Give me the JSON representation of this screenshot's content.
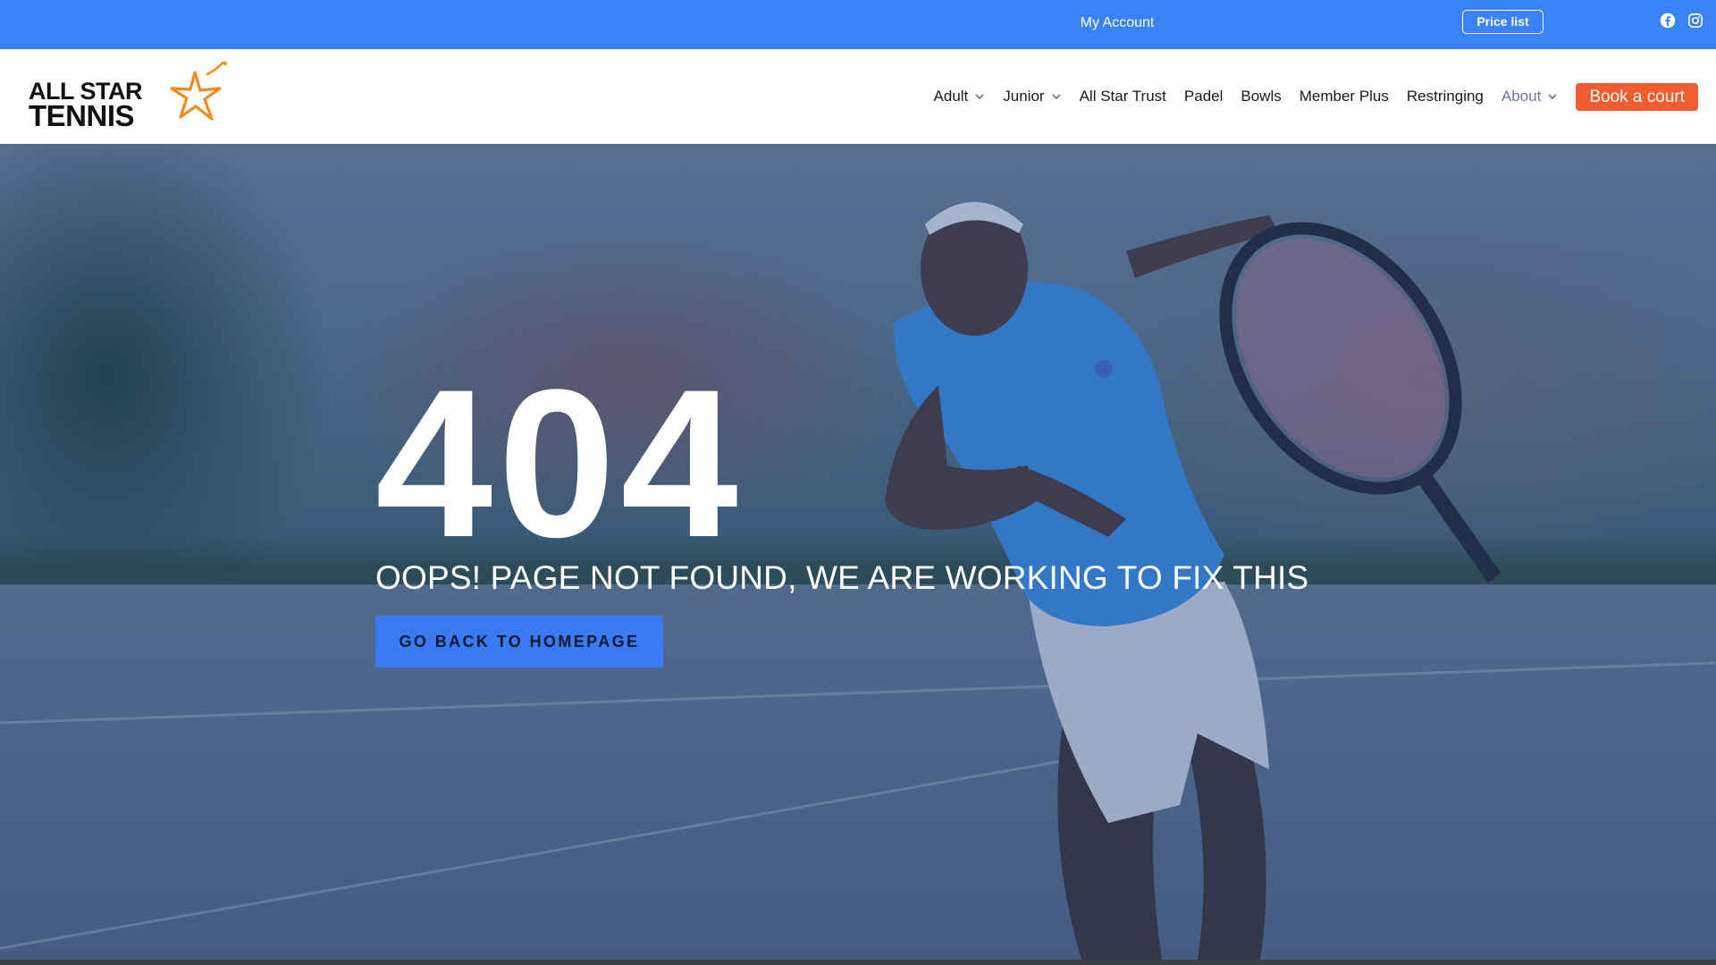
{
  "topbar": {
    "my_account": "My Account",
    "price_list": "Price list",
    "social": [
      "facebook-icon",
      "instagram-icon"
    ]
  },
  "logo": {
    "line1": "ALL STAR",
    "line2": "TENNIS"
  },
  "nav": {
    "items": [
      {
        "label": "Adult",
        "dropdown": true
      },
      {
        "label": "Junior",
        "dropdown": true
      },
      {
        "label": "All Star Trust",
        "dropdown": false
      },
      {
        "label": "Padel",
        "dropdown": false
      },
      {
        "label": "Bowls",
        "dropdown": false
      },
      {
        "label": "Member Plus",
        "dropdown": false
      },
      {
        "label": "Restringing",
        "dropdown": false
      },
      {
        "label": "About",
        "dropdown": true
      }
    ],
    "cta": "Book a court"
  },
  "hero": {
    "code": "404",
    "message": "OOPS! PAGE NOT FOUND, WE ARE WORKING TO FIX THIS",
    "button": "GO BACK TO HOMEPAGE"
  },
  "colors": {
    "topbar": "#3a82f7",
    "cta": "#f25c2e",
    "button": "#3a7bf5",
    "logo_star": "#f28a1e"
  }
}
